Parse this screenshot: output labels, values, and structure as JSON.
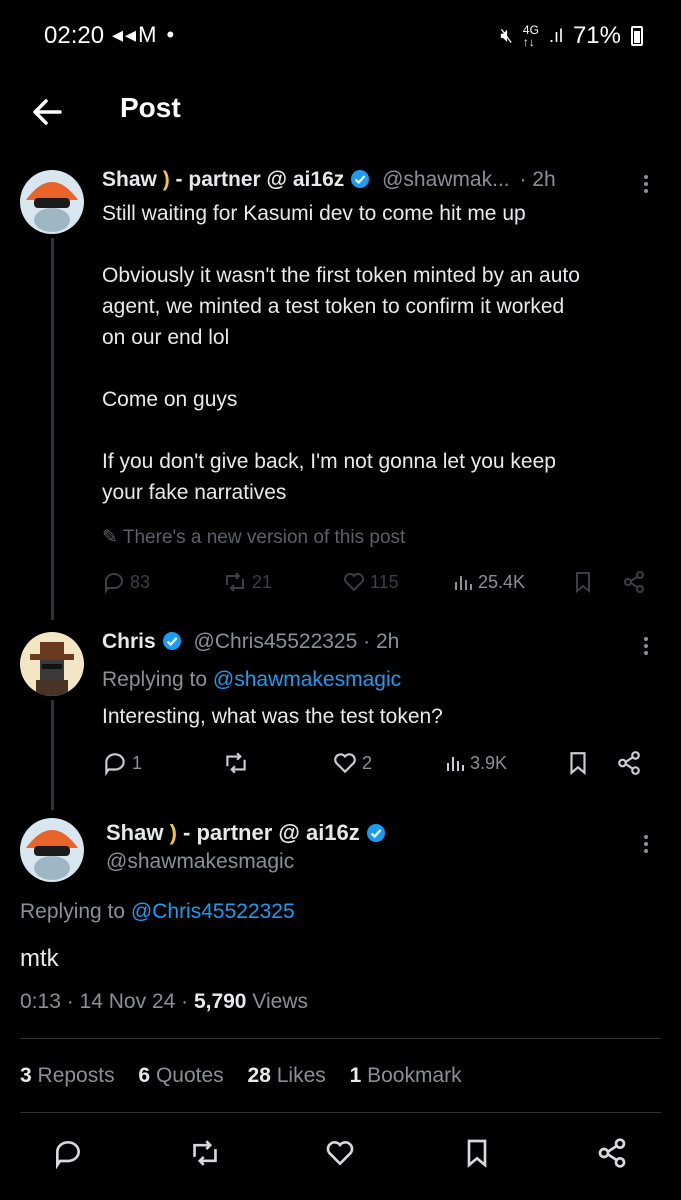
{
  "status_bar": {
    "time": "02:20",
    "left_icons": "◂◂M •",
    "battery": "71%"
  },
  "header": {
    "title": "Post"
  },
  "tweet1": {
    "name": "Shaw",
    "moon": ")",
    "affiliation": "- partner @ ai16z",
    "handle": "@shawmak...",
    "time": "· 2h",
    "lines": [
      "Still waiting for Kasumi dev to come hit me up",
      "",
      "Obviously it wasn't the first token minted by an auto",
      "agent, we minted a test token to confirm it worked",
      "on our end lol",
      "",
      "Come on guys",
      "",
      "If you don't give back, I'm not gonna let you keep",
      "your fake narratives"
    ],
    "edited_notice": "There's a new version of this post",
    "replies": "83",
    "reposts": "21",
    "likes": "115",
    "views": "25.4K"
  },
  "tweet2": {
    "name": "Chris",
    "handle": "@Chris45522325",
    "time": "· 2h",
    "replying_prefix": "Replying to",
    "replying_to": "@shawmakesmagic",
    "text": "Interesting, what was the test token?",
    "replies": "1",
    "reposts": "",
    "likes": "2",
    "views": "3.9K"
  },
  "main_tweet": {
    "name": "Shaw",
    "moon": ")",
    "affiliation": "- partner @ ai16z",
    "handle": "@shawmakesmagic",
    "replying_prefix": "Replying to",
    "replying_to": "@Chris45522325",
    "text": "mtk",
    "timestamp": "0:13 · 14 Nov 24 ·",
    "views_count": "5,790",
    "views_label": "Views",
    "stats": [
      {
        "count": "3",
        "label": "Reposts"
      },
      {
        "count": "6",
        "label": "Quotes"
      },
      {
        "count": "28",
        "label": "Likes"
      },
      {
        "count": "1",
        "label": "Bookmark"
      }
    ]
  },
  "colors": {
    "background": "#000000",
    "text": "#e7e9ea",
    "muted": "#8b9096",
    "link": "#1d9bf0",
    "verified": "#1d9bf0"
  }
}
